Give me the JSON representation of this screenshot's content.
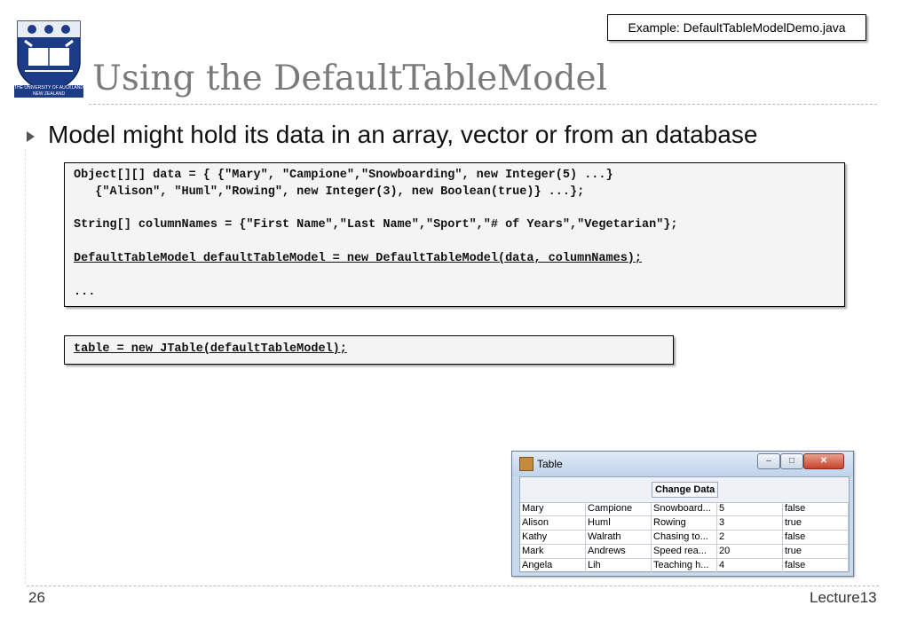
{
  "logo": {
    "caption_line1": "THE UNIVERSITY OF AUCKLAND",
    "caption_line2": "NEW ZEALAND"
  },
  "example_tag": "Example: DefaultTableModelDemo.java",
  "title": "Using the DefaultTableModel",
  "bullet": "Model might hold its data in an array, vector or from an database",
  "code_lines": [
    "Object[][] data = { {\"Mary\", \"Campione\",\"Snowboarding\", new Integer(5) ...}",
    "   {\"Alison\", \"Huml\",\"Rowing\", new Integer(3), new Boolean(true)} ...};",
    "",
    "String[] columnNames = {\"First Name\",\"Last Name\",\"Sport\",\"# of Years\",\"Vegetarian\"};",
    "",
    "DefaultTableModel defaultTableModel = new DefaultTableModel(data, columnNames);",
    "",
    "..."
  ],
  "table_code": "table = new JTable(defaultTableModel);",
  "window": {
    "title": "Table",
    "button_label": "Change Data",
    "rows": [
      [
        "Mary",
        "Campione",
        "Snowboard...",
        "5",
        "false"
      ],
      [
        "Alison",
        "Huml",
        "Rowing",
        "3",
        "true"
      ],
      [
        "Kathy",
        "Walrath",
        "Chasing to...",
        "2",
        "false"
      ],
      [
        "Mark",
        "Andrews",
        "Speed rea...",
        "20",
        "true"
      ],
      [
        "Angela",
        "Lih",
        "Teaching h...",
        "4",
        "false"
      ]
    ]
  },
  "footer": {
    "slide_number": "26",
    "lecture": "Lecture13"
  }
}
